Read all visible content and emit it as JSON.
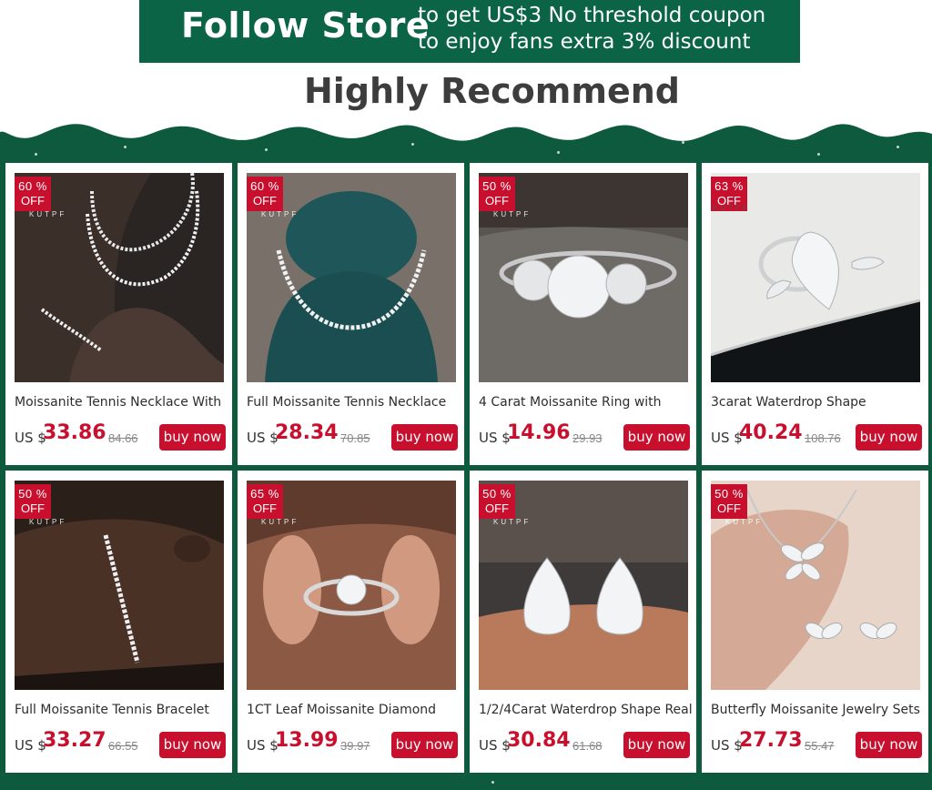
{
  "banner": {
    "title": "Follow Store",
    "line1": "to get US$3 No threshold coupon",
    "line2": "to enjoy fans extra 3% discount"
  },
  "heading": "Highly Recommend",
  "colors": {
    "accent": "#c8102e",
    "brand_green": "#0b6446",
    "background_green": "#0e5a3f"
  },
  "products": [
    {
      "badge_pct": "60 %",
      "badge_off": "OFF",
      "watermark": "KUTPF",
      "title": "Moissanite Tennis Necklace With",
      "currency": "US $",
      "price": "33.86",
      "old_price": "84.66",
      "button": "buy now",
      "image": "tennis-necklace-on-neck-photo"
    },
    {
      "badge_pct": "60 %",
      "badge_off": "OFF",
      "watermark": "KUTPF",
      "title": "Full Moissanite Tennis Necklace",
      "currency": "US $",
      "price": "28.34",
      "old_price": "70.85",
      "button": "buy now",
      "image": "necklace-on-velvet-bust-photo"
    },
    {
      "badge_pct": "50 %",
      "badge_off": "OFF",
      "watermark": "KUTPF",
      "title": "4 Carat Moissanite Ring with",
      "currency": "US $",
      "price": "14.96",
      "old_price": "29.93",
      "button": "buy now",
      "image": "three-stone-ring-photo"
    },
    {
      "badge_pct": "63 %",
      "badge_off": "OFF",
      "watermark": "KUTPF",
      "title": "3carat Waterdrop Shape",
      "currency": "US $",
      "price": "40.24",
      "old_price": "108.76",
      "button": "buy now",
      "image": "pear-ring-photo"
    },
    {
      "badge_pct": "50 %",
      "badge_off": "OFF",
      "watermark": "KUTPF",
      "title": "Full Moissanite Tennis Bracelet",
      "currency": "US $",
      "price": "33.27",
      "old_price": "66.55",
      "button": "buy now",
      "image": "tennis-bracelet-on-wrist-photo"
    },
    {
      "badge_pct": "65 %",
      "badge_off": "OFF",
      "watermark": "KUTPF",
      "title": "1CT Leaf Moissanite Diamond",
      "currency": "US $",
      "price": "13.99",
      "old_price": "39.97",
      "button": "buy now",
      "image": "leaf-ring-in-fingers-photo"
    },
    {
      "badge_pct": "50 %",
      "badge_off": "OFF",
      "watermark": "KUTPF",
      "title": "1/2/4Carat Waterdrop Shape Real",
      "currency": "US $",
      "price": "30.84",
      "old_price": "61.68",
      "button": "buy now",
      "image": "waterdrop-earrings-photo"
    },
    {
      "badge_pct": "50 %",
      "badge_off": "OFF",
      "watermark": "KUTPF",
      "title": "Butterfly Moissanite Jewelry Sets",
      "currency": "US $",
      "price": "27.73",
      "old_price": "55.47",
      "button": "buy now",
      "image": "butterfly-jewelry-set-photo"
    }
  ]
}
